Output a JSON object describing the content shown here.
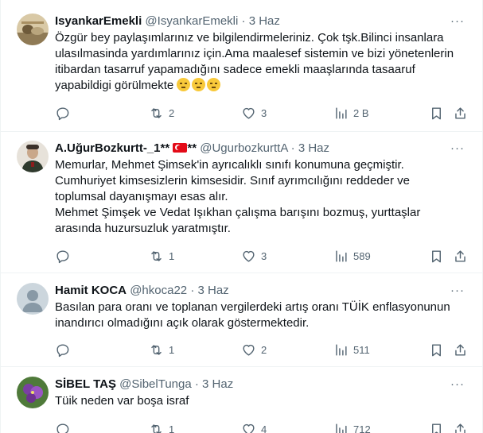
{
  "tweets": [
    {
      "name": "IsyankarEmekli",
      "handle": "@IsyankarEmekli",
      "dot": "·",
      "time": "3 Haz",
      "lines": [
        "Özgür bey paylaşımlarınız ve bilgilendirmeleriniz. Çok tşk.Bilinci insanlara",
        "ulasılmasinda yardımlarınız için.Ama maalesef sistemin ve bizi yönetenlerin",
        "itibardan tasarruf yapamadığını sadece emekli maaşlarında tasaaruf",
        "yapabildigi görülmekte"
      ],
      "emojis": [
        "pensive-face",
        "pensive-face",
        "pensive-face"
      ],
      "replies": "",
      "retweets": "2",
      "likes": "3",
      "views": "2 B"
    },
    {
      "name": "A.UğurBozkurtt-_1**",
      "name_suffix": "**",
      "flag": "turkey-flag",
      "handle": "@UgurbozkurttA",
      "dot": "·",
      "time": "3 Haz",
      "lines": [
        "Memurlar, Mehmet Şimsek'in ayrıcalıklı sınıfı konumuna geçmiştir.",
        "Cumhuriyet kimsesizlerin kimsesidir. Sınıf ayrımcılığını reddeder ve",
        "toplumsal dayanışmayı esas alır.",
        "Mehmet Şimşek ve Vedat Işıkhan çalışma barışını bozmuş, yurttaşlar",
        "arasında huzursuzluk yaratmıştır."
      ],
      "replies": "",
      "retweets": "1",
      "likes": "3",
      "views": "589"
    },
    {
      "name": "Hamit KOCA",
      "handle": "@hkoca22",
      "dot": "·",
      "time": "3 Haz",
      "lines": [
        "Basılan para oranı  ve toplanan vergilerdeki artış oranı TÜİK enflasyonunun",
        "inandırıcı olmadığını açık olarak göstermektedir."
      ],
      "replies": "",
      "retweets": "1",
      "likes": "2",
      "views": "511"
    },
    {
      "name": "SİBEL TAŞ",
      "handle": "@SibelTunga",
      "dot": "·",
      "time": "3 Haz",
      "lines": [
        "Tüik neden var boşa israf"
      ],
      "replies": "",
      "retweets": "1",
      "likes": "4",
      "views": "712"
    }
  ],
  "more_label": "···",
  "colors": {
    "text": "#0f1419",
    "secondary": "#536471",
    "border": "#eff3f4"
  }
}
